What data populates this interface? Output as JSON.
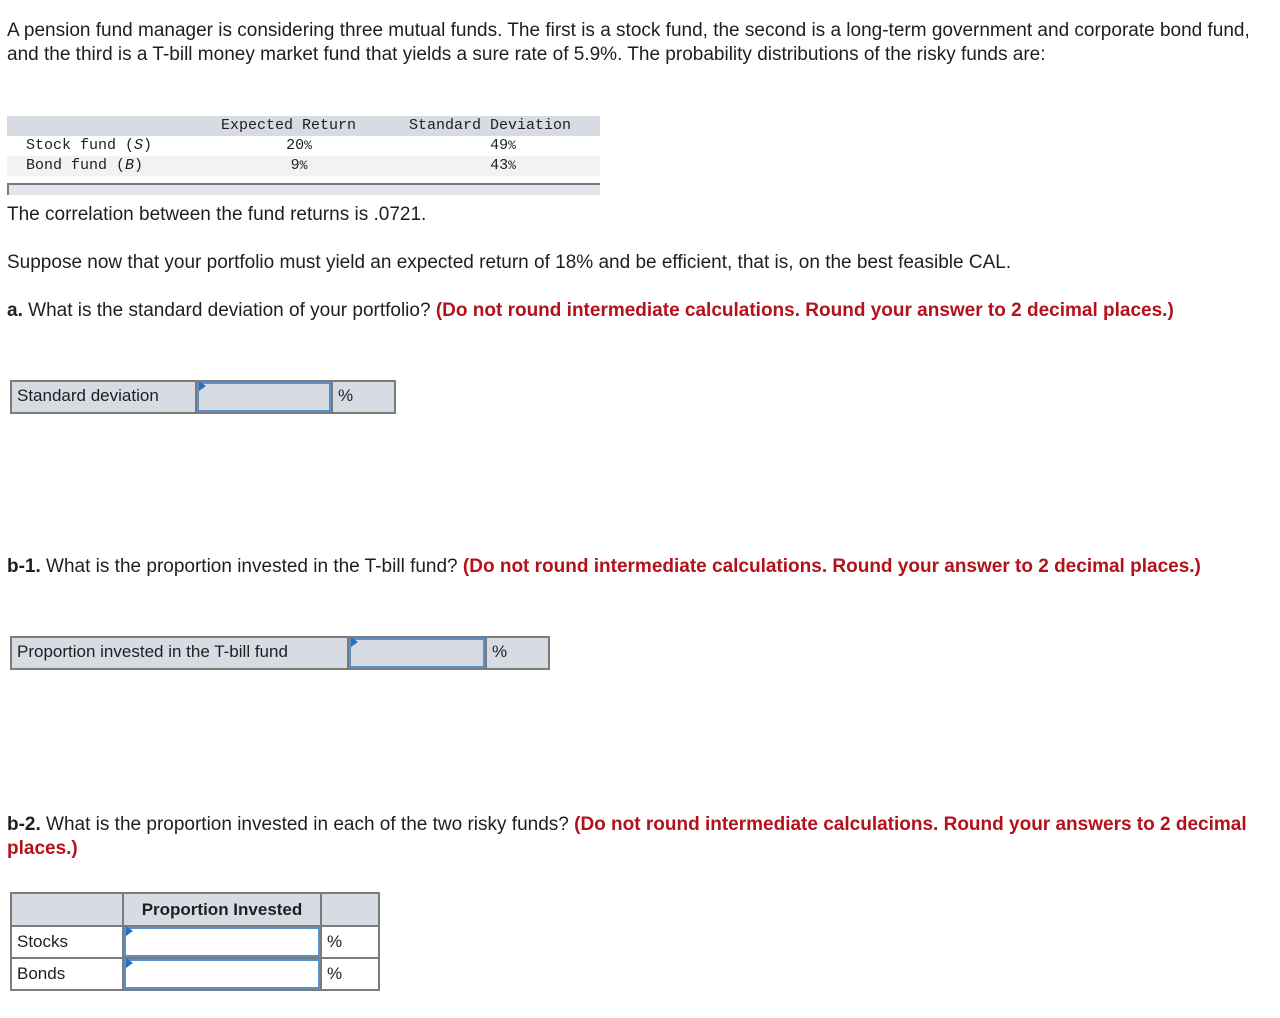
{
  "intro": "A pension fund manager is considering three mutual funds. The first is a stock fund, the second is a long-term government and corporate bond fund, and the third is a T-bill money market fund that yields a sure rate of 5.9%. The probability distributions of the risky funds are:",
  "fund_table": {
    "headers": [
      "",
      "Expected Return",
      "Standard Deviation"
    ],
    "rows": [
      {
        "name": "Stock fund (",
        "symbol": "S",
        "close": ")",
        "expected_return": "20",
        "std_dev": "49"
      },
      {
        "name": "Bond fund (",
        "symbol": "B",
        "close": ")",
        "expected_return": "9",
        "std_dev": "43"
      }
    ],
    "percent_sign": "%"
  },
  "correlation": "The correlation between the fund returns is .0721.",
  "suppose": "Suppose now that your portfolio must yield an expected return of 18% and be efficient, that is, on the best feasible CAL.",
  "question_a": {
    "label": "a.",
    "text": " What is the standard deviation of your portfolio? ",
    "instruction": "(Do not round intermediate calculations. Round your answer to 2 decimal places.)",
    "row_label": "Standard deviation",
    "value": "",
    "unit": "%"
  },
  "question_b1": {
    "label": "b-1.",
    "text": " What is the proportion invested in the T-bill fund? ",
    "instruction": "(Do not round intermediate calculations. Round your answer to 2 decimal places.)",
    "row_label": "Proportion invested in the T-bill fund",
    "value": "",
    "unit": "%"
  },
  "question_b2": {
    "label": "b-2.",
    "text": " What is the proportion invested in each of the two risky funds? ",
    "instruction": "(Do not round intermediate calculations. Round your answers to 2 decimal places.)",
    "column_header": "Proportion Invested",
    "rows": [
      {
        "label": "Stocks",
        "value": "",
        "unit": "%"
      },
      {
        "label": "Bonds",
        "value": "",
        "unit": "%"
      }
    ]
  },
  "colors": {
    "instruction_red": "#b3121b",
    "header_bg": "#d7dbe3",
    "input_border": "#5b8fc9"
  }
}
